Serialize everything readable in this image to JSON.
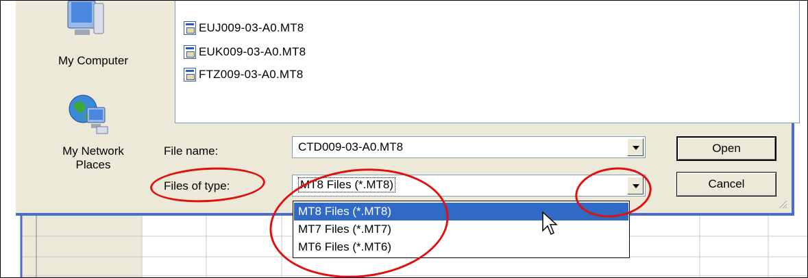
{
  "files": [
    {
      "name": "EUJ009-03-A0.MT8"
    },
    {
      "name": "EUK009-03-A0.MT8"
    },
    {
      "name": "FTZ009-03-A0.MT8"
    }
  ],
  "places": {
    "my_computer": "My Computer",
    "my_network_line1": "My Network",
    "my_network_line2": "Places"
  },
  "form": {
    "file_name_label": "File name:",
    "file_name_value": "CTD009-03-A0.MT8",
    "file_type_label": "Files of type:",
    "file_type_value": "MT8 Files (*.MT8)"
  },
  "buttons": {
    "open": "Open",
    "cancel": "Cancel"
  },
  "dropdown_options": [
    "MT8 Files (*.MT8)",
    "MT7 Files (*.MT7)",
    "MT6 Files (*.MT6)"
  ],
  "selected_option_index": 0,
  "colors": {
    "dialog_bg": "#ece9d8",
    "selection": "#316ac5",
    "annotation": "#e01010",
    "border_blue": "#4a6bd0"
  }
}
